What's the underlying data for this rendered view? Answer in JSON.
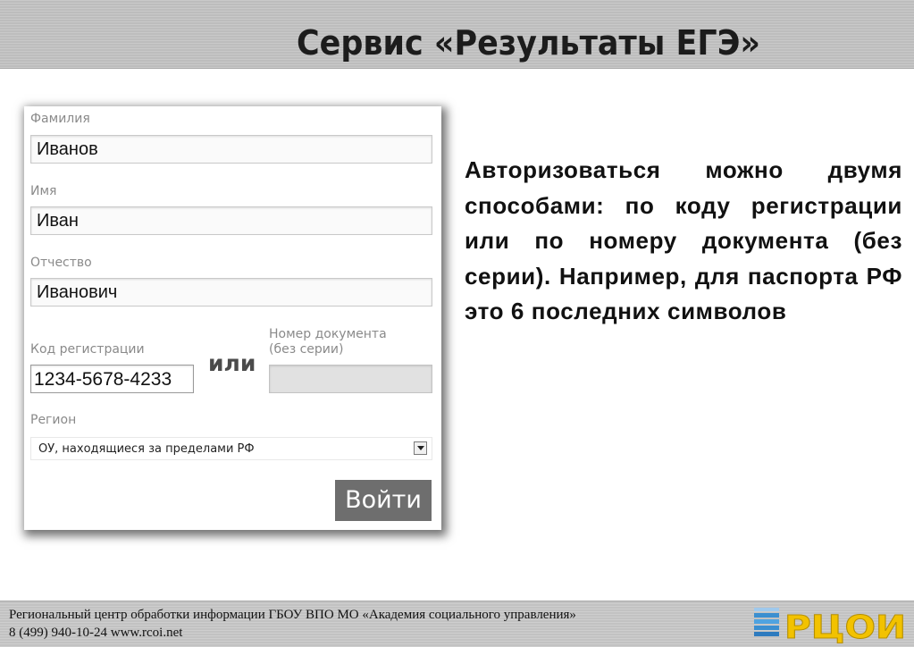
{
  "header": {
    "title": "Сервис «Результаты ЕГЭ»"
  },
  "form": {
    "surname_label": "Фамилия",
    "surname_value": "Иванов",
    "name_label": "Имя",
    "name_value": "Иван",
    "patronymic_label": "Отчество",
    "patronymic_value": "Иванович",
    "reg_code_label": "Код регистрации",
    "reg_code_value": "1234-5678-4233",
    "or_label": "или",
    "doc_number_label_line1": "Номер документа",
    "doc_number_label_line2": "(без серии)",
    "doc_number_value": "",
    "region_label": "Регион",
    "region_selected": "ОУ, находящиеся за пределами РФ",
    "submit_label": "Войти"
  },
  "description": {
    "text": "Авторизоваться можно двумя способами: по коду регистрации или по номеру документа (без серии). Например, для паспорта РФ это 6 последних символов"
  },
  "footer": {
    "line1": "Региональный центр обработки информации ГБОУ ВПО МО «Академия социального управления»",
    "line2": "8 (499) 940-10-24 www.rcoi.net",
    "logo_text": "РЦОИ"
  },
  "colors": {
    "header_bg": "#c3c3c3",
    "button_bg": "#6e6e6e",
    "logo_yellow": "#f2c200",
    "logo_blue": "#3b8fd0"
  }
}
